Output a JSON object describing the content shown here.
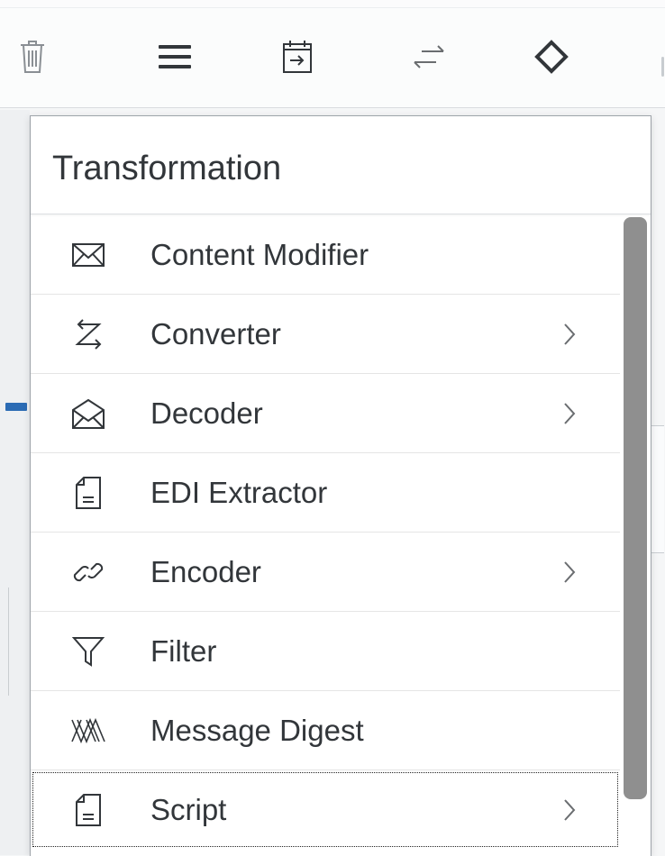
{
  "toolbar": {
    "icons": [
      "trash-icon",
      "menu-icon",
      "calendar-icon",
      "exchange-icon",
      "gateway-icon"
    ]
  },
  "popover": {
    "title": "Transformation",
    "items": [
      {
        "label": "Content Modifier",
        "icon": "envelope-icon",
        "submenu": false
      },
      {
        "label": "Converter",
        "icon": "converter-icon",
        "submenu": true
      },
      {
        "label": "Decoder",
        "icon": "open-envelope-icon",
        "submenu": true
      },
      {
        "label": "EDI Extractor",
        "icon": "document-icon",
        "submenu": false
      },
      {
        "label": "Encoder",
        "icon": "link-icon",
        "submenu": true
      },
      {
        "label": "Filter",
        "icon": "filter-icon",
        "submenu": false
      },
      {
        "label": "Message Digest",
        "icon": "digest-icon",
        "submenu": false
      },
      {
        "label": "Script",
        "icon": "script-icon",
        "submenu": true,
        "focused": true
      }
    ]
  },
  "colors": {
    "text": "#32363a",
    "icon": "#32363a",
    "scrollbar": "#8f8f8f",
    "tag": "#2b6bb4"
  }
}
